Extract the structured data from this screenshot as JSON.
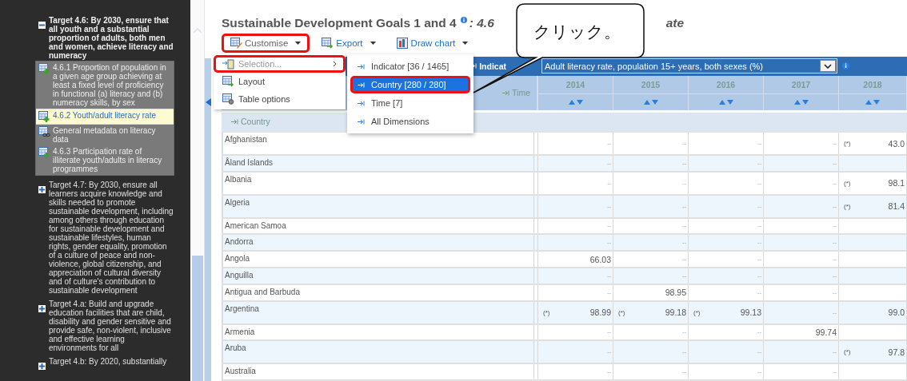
{
  "sidebar": {
    "targets": [
      {
        "label": "Target 4.6: By 2030, ensure that all youth and a substantial proportion of adults, both men and women, achieve literacy and numeracy",
        "expanded": true,
        "children": [
          {
            "label": "4.6.1 Proportion of population in a given age group achieving at least a fixed level of proficiency in functional (a) literacy and (b) numeracy skills, by sex",
            "kind": "indicator",
            "selected": false
          },
          {
            "label": "4.6.2 Youth/adult literacy rate",
            "kind": "indicator",
            "selected": true
          },
          {
            "label": "General metadata on literacy data",
            "kind": "metadata",
            "selected": false
          },
          {
            "label": "4.6.3 Participation rate of illiterate youth/adults in literacy programmes",
            "kind": "indicator",
            "selected": false
          }
        ]
      },
      {
        "label": "Target 4.7: By 2030, ensure all learners acquire knowledge and skills needed to promote sustainable development, including among others through education for sustainable development and sustainable lifestyles, human rights, gender equality, promotion of a culture of peace and non-violence, global citizenship, and appreciation of cultural diversity and of culture's contribution to sustainable development",
        "expanded": false
      },
      {
        "label": "Target 4.a: Build and upgrade education facilities that are child, disability and gender sensitive and provide safe, non-violent, inclusive and effective learning environments for all",
        "expanded": false
      },
      {
        "label": "Target 4.b: By 2020, substantially",
        "expanded": false
      }
    ]
  },
  "title": {
    "text": "Sustainable Development Goals 1 and 4",
    "subtitle_start": ": 4.6",
    "subtitle_end": "ate"
  },
  "callout": {
    "text": "クリック。"
  },
  "toolbar": [
    {
      "label": "Customise",
      "kind": "customise",
      "highlighted": true
    },
    {
      "label": "Export",
      "kind": "export",
      "highlighted": false
    },
    {
      "label": "Draw chart",
      "kind": "chart",
      "highlighted": false
    }
  ],
  "customise_menu": [
    {
      "label": "Selection...",
      "kind": "selection",
      "disabled": true,
      "highlighted": true
    },
    {
      "label": "Layout",
      "kind": "layout",
      "disabled": false,
      "highlighted": false
    },
    {
      "label": "Table options",
      "kind": "options",
      "disabled": false,
      "highlighted": false
    }
  ],
  "selection_submenu": [
    {
      "label": "Indicator [36 / 1465]",
      "selected": false,
      "highlighted": false
    },
    {
      "label": "Country [280 / 280]",
      "selected": true,
      "highlighted": true
    },
    {
      "label": "Time [7]",
      "selected": false,
      "highlighted": false
    },
    {
      "label": "All Dimensions",
      "selected": false,
      "highlighted": false
    }
  ],
  "table": {
    "indicator_label": "Indicat",
    "indicator_value": "Adult literacy rate, population 15+ years, both sexes (%)",
    "time_label": "Time",
    "country_label": "Country",
    "years": [
      "2014",
      "2015",
      "2016",
      "2017",
      "2018"
    ],
    "rows": [
      {
        "country": "Afghanistan",
        "cells": [
          {
            "value": "--"
          },
          {
            "value": "--"
          },
          {
            "value": "--"
          },
          {
            "value": "--"
          },
          {
            "flag": "(*)",
            "value": "43.0"
          }
        ]
      },
      {
        "country": "Åland Islands",
        "cells": [
          {
            "value": "--"
          },
          {
            "value": "--"
          },
          {
            "value": "--"
          },
          {
            "value": "--"
          },
          {}
        ]
      },
      {
        "country": "Albania",
        "cells": [
          {
            "value": "--"
          },
          {
            "value": "--"
          },
          {
            "value": "--"
          },
          {
            "value": "--"
          },
          {
            "flag": "(*)",
            "value": "98.1"
          }
        ]
      },
      {
        "country": "Algeria",
        "cells": [
          {
            "value": "--"
          },
          {
            "value": "--"
          },
          {
            "value": "--"
          },
          {
            "value": "--"
          },
          {
            "flag": "(*)",
            "value": "81.4"
          }
        ]
      },
      {
        "country": "American Samoa",
        "cells": [
          {
            "value": "--"
          },
          {
            "value": "--"
          },
          {
            "value": "--"
          },
          {
            "value": "--"
          },
          {}
        ]
      },
      {
        "country": "Andorra",
        "cells": [
          {
            "value": "--"
          },
          {
            "value": "--"
          },
          {
            "value": "--"
          },
          {
            "value": "--"
          },
          {}
        ]
      },
      {
        "country": "Angola",
        "cells": [
          {
            "value": "66.03"
          },
          {
            "value": "--"
          },
          {
            "value": "--"
          },
          {
            "value": "--"
          },
          {}
        ]
      },
      {
        "country": "Anguilla",
        "cells": [
          {
            "value": "--"
          },
          {
            "value": "--"
          },
          {
            "value": "--"
          },
          {
            "value": "--"
          },
          {}
        ]
      },
      {
        "country": "Antigua and Barbuda",
        "cells": [
          {
            "value": "--"
          },
          {
            "value": "98.95"
          },
          {
            "value": "--"
          },
          {
            "value": "--"
          },
          {}
        ]
      },
      {
        "country": "Argentina",
        "cells": [
          {
            "flag": "(*)",
            "value": "98.99"
          },
          {
            "flag": "(*)",
            "value": "99.18"
          },
          {
            "flag": "(*)",
            "value": "99.13"
          },
          {
            "value": "--"
          },
          {
            "value": "99.0"
          }
        ]
      },
      {
        "country": "Armenia",
        "cells": [
          {
            "value": "--"
          },
          {
            "value": "--"
          },
          {
            "value": "--"
          },
          {
            "value": "99.74"
          },
          {}
        ]
      },
      {
        "country": "Aruba",
        "cells": [
          {
            "value": "--"
          },
          {
            "value": "--"
          },
          {
            "value": "--"
          },
          {
            "value": "--"
          },
          {
            "flag": "(*)",
            "value": "97.8"
          }
        ]
      },
      {
        "country": "Australia",
        "cells": [
          {
            "value": "--"
          },
          {
            "value": "--"
          },
          {
            "value": "--"
          },
          {
            "value": "--"
          },
          {}
        ]
      }
    ]
  }
}
